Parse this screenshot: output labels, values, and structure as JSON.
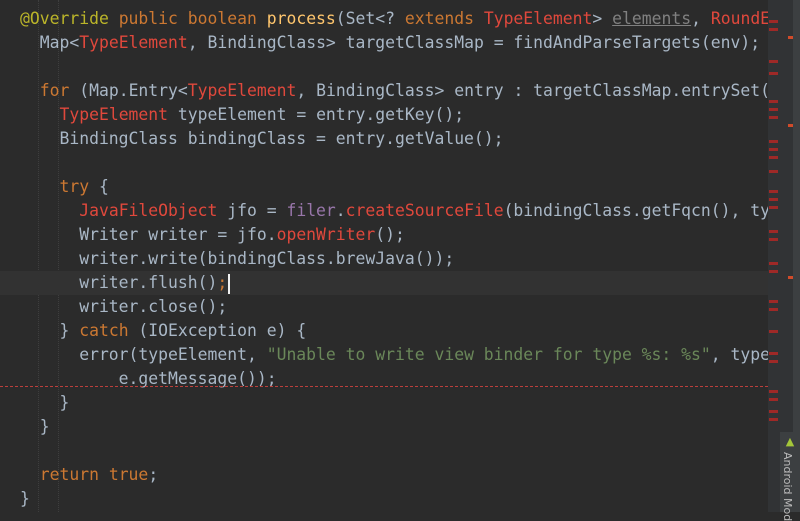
{
  "editor": {
    "lines": [
      "@Override public boolean process(Set<? extends TypeElement> elements, RoundEnviron",
      "  Map<TypeElement, BindingClass> targetClassMap = findAndParseTargets(env);",
      "",
      "  for (Map.Entry<TypeElement, BindingClass> entry : targetClassMap.entrySet()) {",
      "    TypeElement typeElement = entry.getKey();",
      "    BindingClass bindingClass = entry.getValue();",
      "",
      "    try {",
      "      JavaFileObject jfo = filer.createSourceFile(bindingClass.getFqcn(), typeEle",
      "      Writer writer = jfo.openWriter();",
      "      writer.write(bindingClass.brewJava());",
      "      writer.flush();",
      "      writer.close();",
      "    } catch (IOException e) {",
      "      error(typeElement, \"Unable to write view binder for type %s: %s\", typeElemen",
      "          e.getMessage());",
      "    }",
      "  }",
      "",
      "  return true;",
      "}"
    ],
    "current_line_index": 11
  },
  "side_panel": {
    "android_tab_label": "Android Mod",
    "android_icon": "android-icon"
  },
  "colors": {
    "background": "#2b2b2b",
    "keyword": "#cc7832",
    "annotation": "#bbb529",
    "error": "#e0483c",
    "field": "#9876aa",
    "string": "#6a8759",
    "text": "#a9b7c6",
    "error_marker": "#9e2927"
  }
}
